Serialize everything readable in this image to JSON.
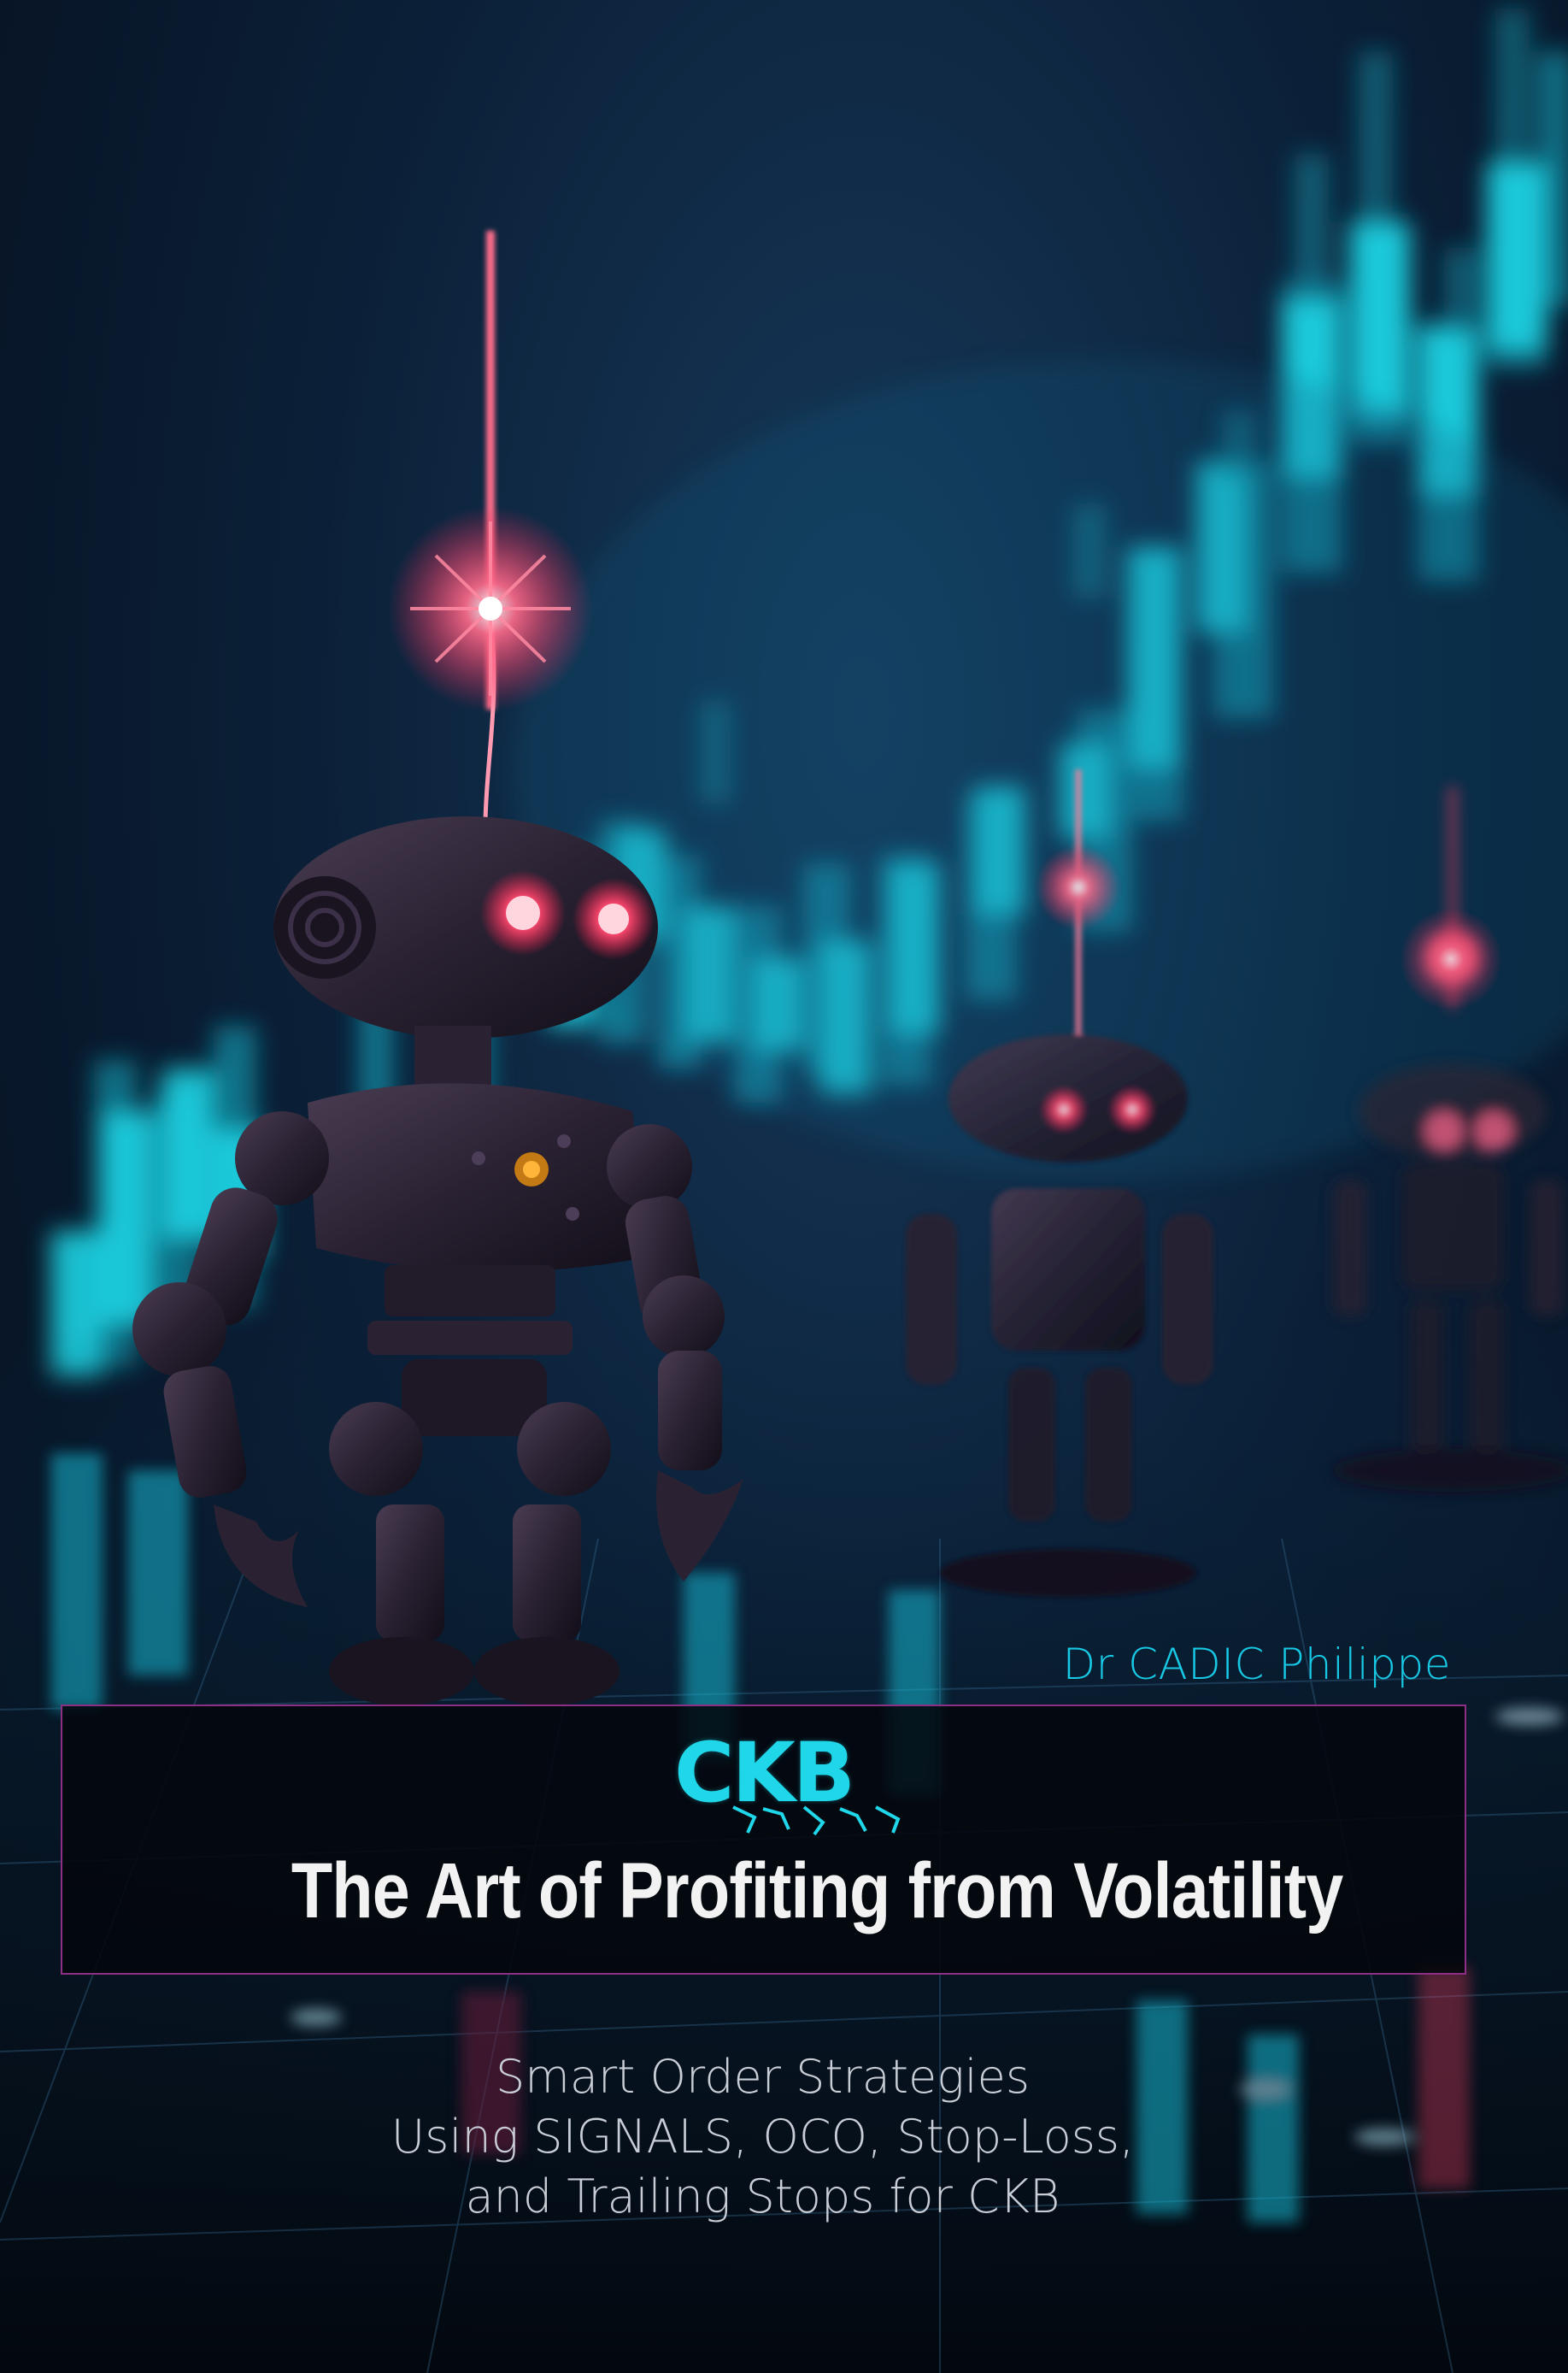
{
  "cover": {
    "author": "Dr CADIC Philippe",
    "logo_text": "CKB",
    "title": "The Art of Profiting from Volatility",
    "subtitle_lines": [
      "Smart Order Strategies",
      "Using SIGNALS, OCO, Stop-Loss,",
      "and Trailing Stops for CKB"
    ]
  },
  "colors": {
    "accent_cyan": "#18c9e6",
    "robot_eye_red": "#ff3f66",
    "frame_border": "#8e2f86",
    "title_text": "#f2f2f2",
    "subtitle_text": "#c8cdd6"
  }
}
